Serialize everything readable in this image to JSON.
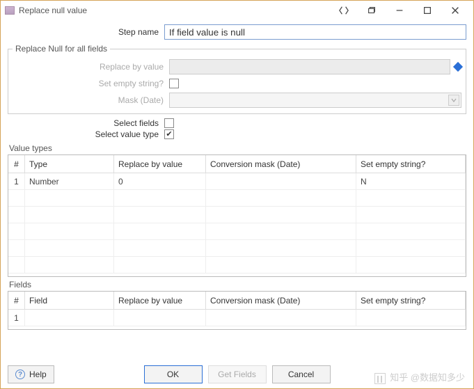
{
  "window": {
    "title": "Replace null value"
  },
  "form": {
    "stepname_label": "Step name",
    "stepname_value": "If field value is null",
    "group_legend": "Replace Null for all fields",
    "replace_by_value_label": "Replace by value",
    "replace_by_value_value": "",
    "set_empty_string_label": "Set empty string?",
    "mask_date_label": "Mask (Date)",
    "select_fields_label": "Select fields",
    "select_fields_checked": false,
    "select_value_type_label": "Select value type",
    "select_value_type_checked": true
  },
  "value_types_section": {
    "label": "Value types",
    "headers": {
      "idx": "#",
      "type": "Type",
      "replace": "Replace by value",
      "conv": "Conversion mask (Date)",
      "empty": "Set empty string?"
    },
    "rows": [
      {
        "idx": "1",
        "type": "Number",
        "replace": "0",
        "conv": "",
        "empty": "N"
      }
    ]
  },
  "fields_section": {
    "label": "Fields",
    "headers": {
      "idx": "#",
      "field": "Field",
      "replace": "Replace by value",
      "conv": "Conversion mask (Date)",
      "empty": "Set empty string?"
    },
    "rows": [
      {
        "idx": "1",
        "field": "",
        "replace": "",
        "conv": "",
        "empty": ""
      }
    ]
  },
  "footer": {
    "help": "Help",
    "ok": "OK",
    "get_fields": "Get Fields",
    "cancel": "Cancel"
  },
  "watermark": "知乎 @数据知多少"
}
